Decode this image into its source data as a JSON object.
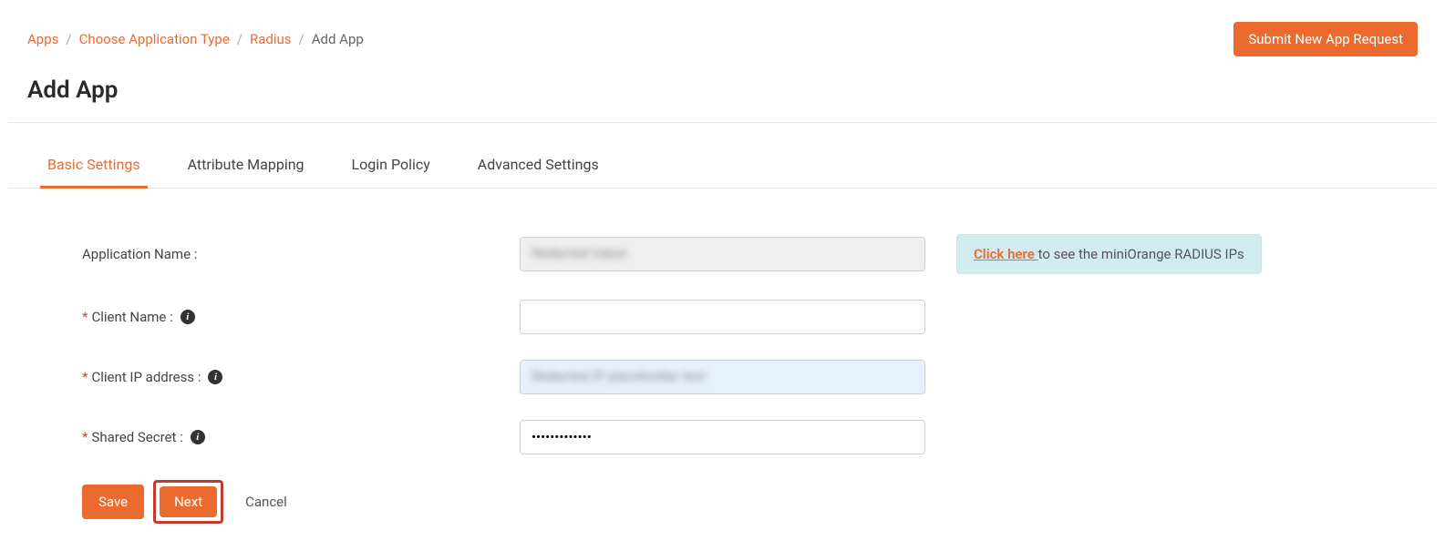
{
  "breadcrumb": {
    "apps": "Apps",
    "choose_type": "Choose Application Type",
    "radius": "Radius",
    "current": "Add App"
  },
  "header": {
    "submit_request": "Submit New App Request",
    "page_title": "Add App"
  },
  "tabs": {
    "basic": "Basic Settings",
    "attribute": "Attribute Mapping",
    "login": "Login Policy",
    "advanced": "Advanced Settings"
  },
  "form": {
    "app_name_label": "Application Name :",
    "app_name_value": "Redacted   Value",
    "client_name_label": "Client Name :",
    "client_name_value": "",
    "client_ip_label": "Client IP address :",
    "client_ip_value": "Redacted IP placeholder text",
    "shared_secret_label": "Shared Secret :",
    "shared_secret_value": "•••••••••••••"
  },
  "info_box": {
    "link_text": "Click here ",
    "rest_text": "to see the miniOrange RADIUS IPs"
  },
  "buttons": {
    "save": "Save",
    "next": "Next",
    "cancel": "Cancel"
  }
}
